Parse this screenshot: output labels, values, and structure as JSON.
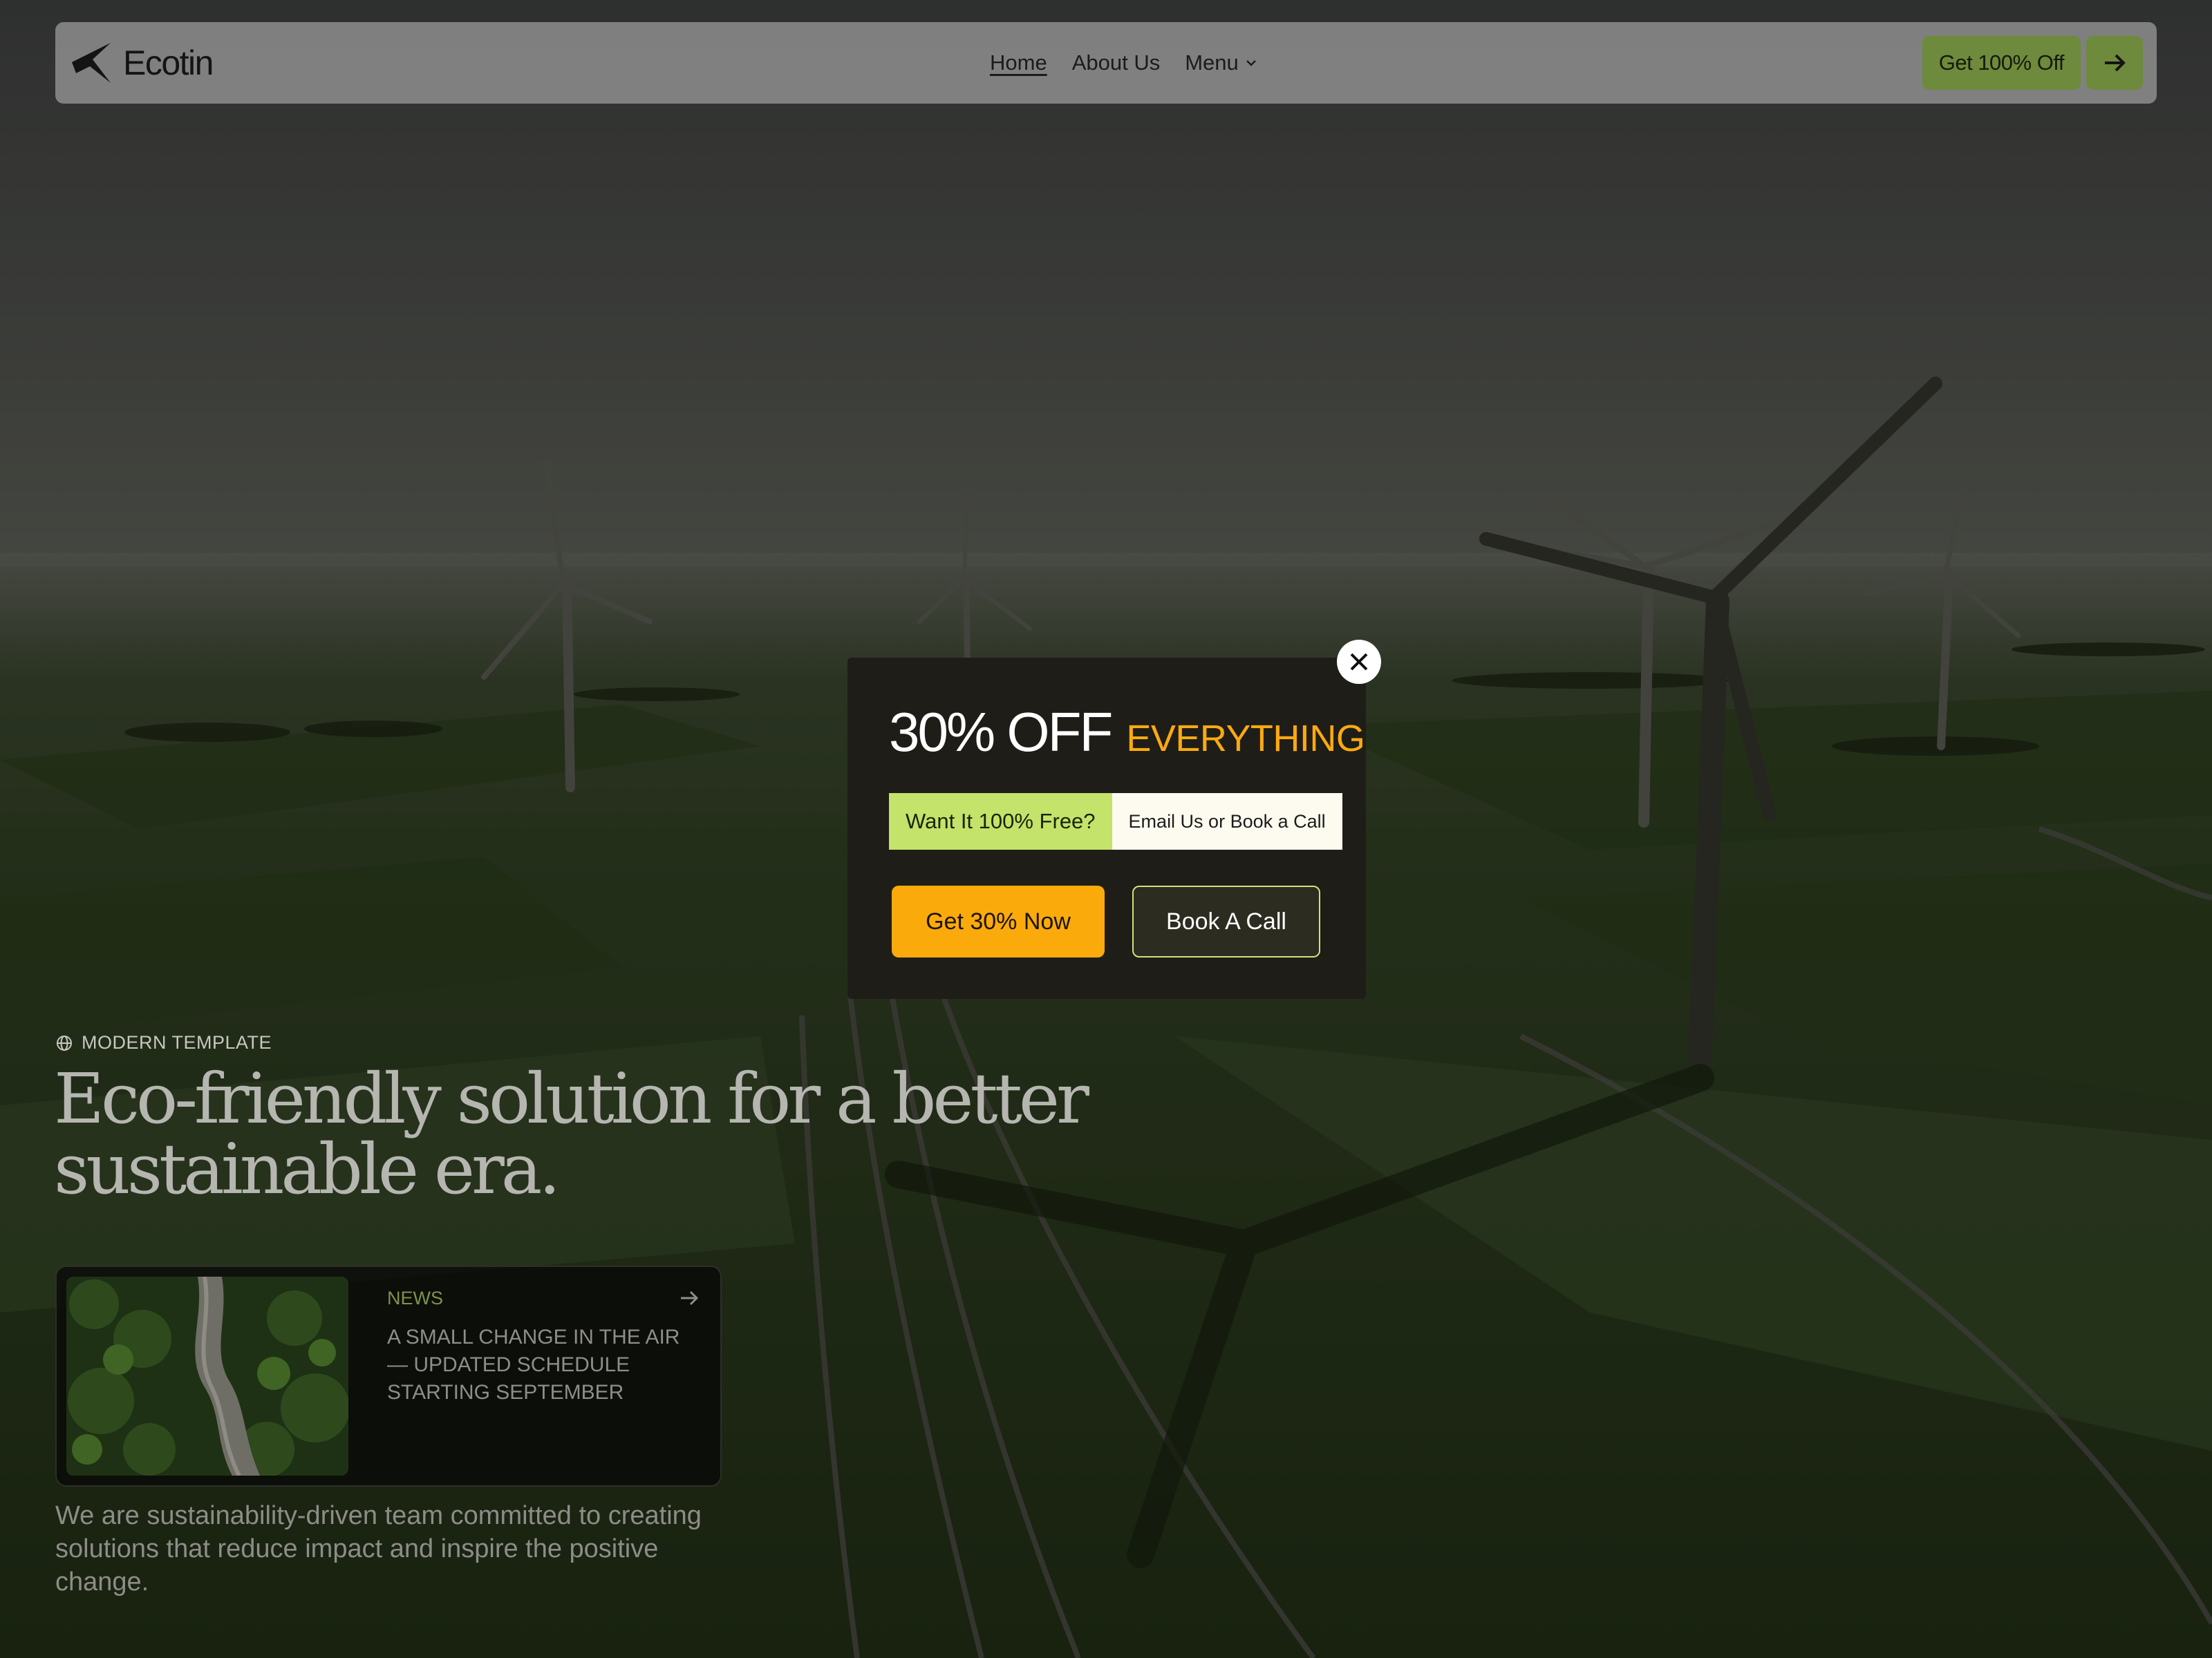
{
  "nav": {
    "brand": "Ecotin",
    "links": [
      {
        "label": "Home",
        "active": true
      },
      {
        "label": "About Us",
        "active": false
      }
    ],
    "menu_label": "Menu",
    "cta_label": "Get 100% Off"
  },
  "hero": {
    "tag": "MODERN TEMPLATE",
    "title": "Eco-friendly solution for a better sustainable era.",
    "description": "We are sustainability-driven team committed to creating solutions that reduce impact and inspire the positive change."
  },
  "news": {
    "category": "NEWS",
    "title": "A SMALL CHANGE IN THE AIR — UPDATED SCHEDULE STARTING SEPTEMBER"
  },
  "popup": {
    "headline": "30% OFF",
    "headline_accent": "EVERYTHING",
    "pill_question": "Want It 100% Free?",
    "pill_answer": "Email Us or Book a Call",
    "primary_button": "Get 30% Now",
    "secondary_button": "Book A Call"
  },
  "colors": {
    "accent_orange": "#fbaa10",
    "accent_lime": "#c3e36a",
    "nav_cta_green": "#6e8a3c"
  },
  "icons": [
    "logo-icon",
    "chevron-down-icon",
    "arrow-right-icon",
    "globe-icon",
    "close-icon"
  ]
}
